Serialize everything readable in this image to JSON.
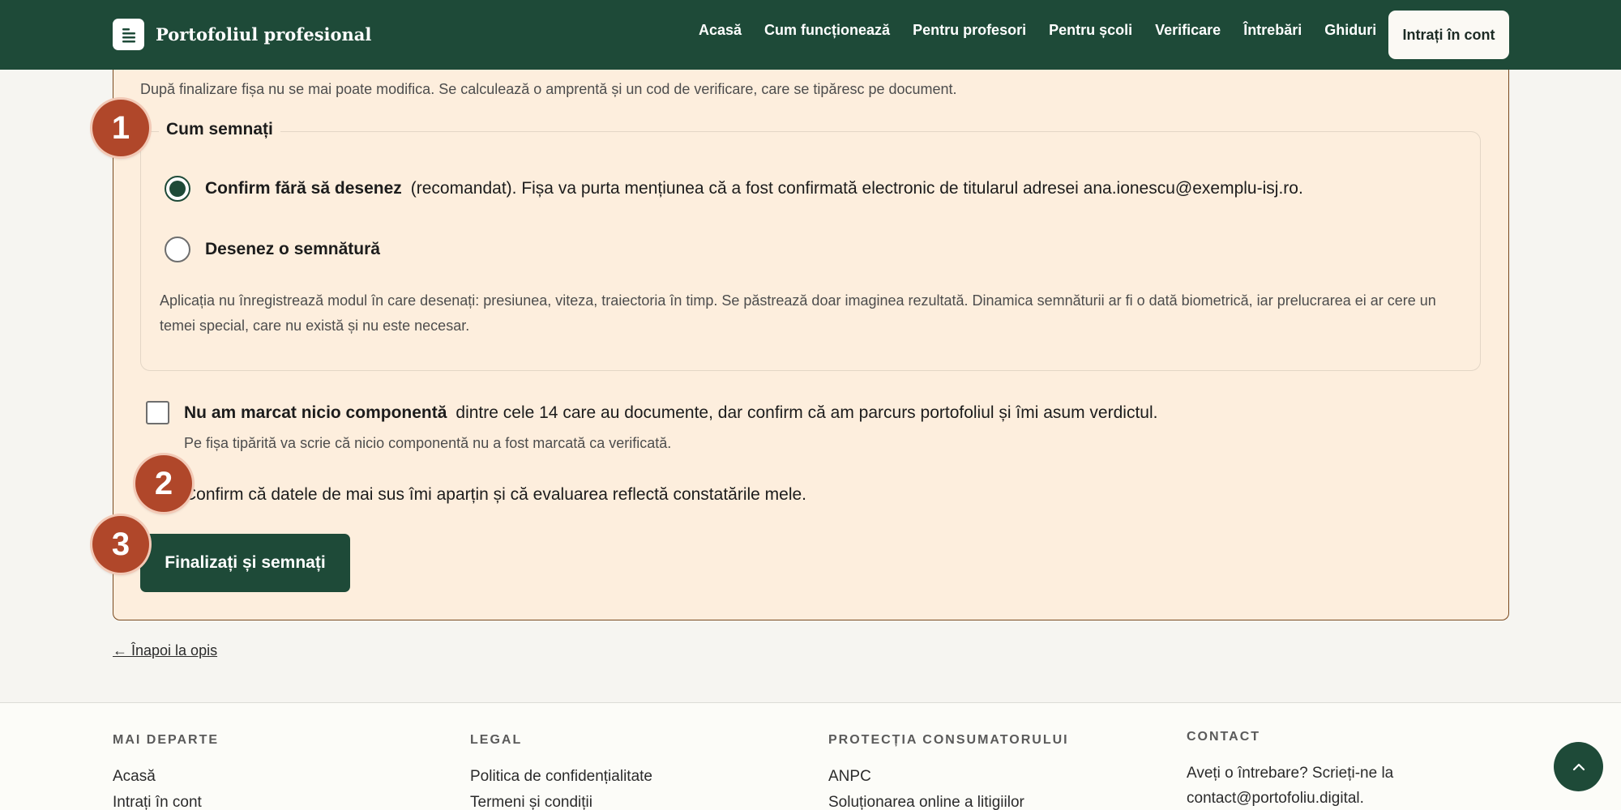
{
  "header": {
    "brand": "Portofoliul profesional",
    "nav": [
      {
        "label": "Acasă"
      },
      {
        "label": "Cum funcționează"
      },
      {
        "label": "Pentru profesori"
      },
      {
        "label": "Pentru școli"
      },
      {
        "label": "Verificare"
      },
      {
        "label": "Întrebări"
      },
      {
        "label": "Ghiduri"
      }
    ],
    "login": "Intrați în cont"
  },
  "form": {
    "intro": "După finalizare fișa nu se mai poate modifica. Se calculează o amprentă și un cod de verificare, care se tipăresc pe document.",
    "legend": "Cum semnați",
    "options": [
      {
        "label": "Confirm fără să desenez",
        "description": "(recomandat). Fișa va purta mențiunea că a fost confirmată electronic de titularul adresei ana.ionescu@exemplu-isj.ro.",
        "selected": true
      },
      {
        "label": "Desenez o semnătură",
        "description": "",
        "selected": false
      }
    ],
    "hint": "Aplicația nu înregistrează modul în care desenați: presiunea, viteza, traiectoria în timp. Se păstrează doar imaginea rezultată. Dinamica semnăturii ar fi o dată biometrică, iar prelucrarea ei ar cere un temei special, care nu există și nu este necesar.",
    "no_component": {
      "label": "Nu am marcat nicio componentă",
      "description": "dintre cele 14 care au documente, dar confirm că am parcurs portofoliul și îmi asum verdictul.",
      "note": "Pe fișa tipărită va scrie că nicio componentă nu a fost marcată ca verificată.",
      "checked": false
    },
    "confirm": "Confirm că datele de mai sus îmi aparțin și că evaluarea reflectă constatările mele.",
    "submit": "Finalizați și semnați"
  },
  "markers": [
    "1",
    "2",
    "3"
  ],
  "back_link": "← Înapoi la opis",
  "footer": {
    "columns": [
      {
        "heading": "MAI DEPARTE",
        "links": [
          "Acasă",
          "Intrați în cont"
        ]
      },
      {
        "heading": "LEGAL",
        "links": [
          "Politica de confidențialitate",
          "Termeni și condiții"
        ]
      },
      {
        "heading": "PROTECȚIA CONSUMATORULUI",
        "links": [
          "ANPC",
          "Soluționarea online a litigiilor"
        ]
      }
    ],
    "contact": {
      "heading": "CONTACT",
      "text": "Aveți o întrebare? Scrieți-ne la contact@portofoliu.digital."
    }
  },
  "colors": {
    "brand": "#1e4a38",
    "card_bg": "#fdeedd",
    "card_border": "#7a4a1f",
    "marker": "#b0472a"
  },
  "icons": {
    "logo": "document-lines-icon",
    "scroll_top": "chevron-up-icon"
  }
}
